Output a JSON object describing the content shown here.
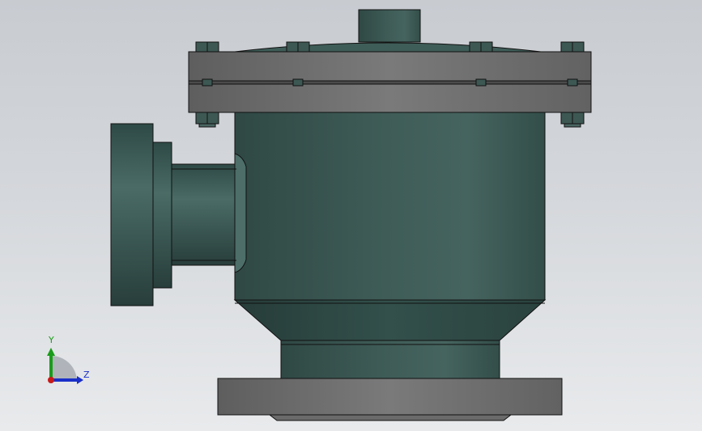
{
  "viewport": {
    "background_top": "#c8ccd1",
    "background_bottom": "#e8eaec",
    "model": {
      "part_color": "#3f5c57",
      "flange_color": "#737373",
      "edge_color": "#111111"
    }
  },
  "triad": {
    "y_label": "Y",
    "z_label": "Z",
    "y_color": "#1a9c1a",
    "z_color": "#1a2fc8",
    "x_color": "#c81a1a"
  }
}
